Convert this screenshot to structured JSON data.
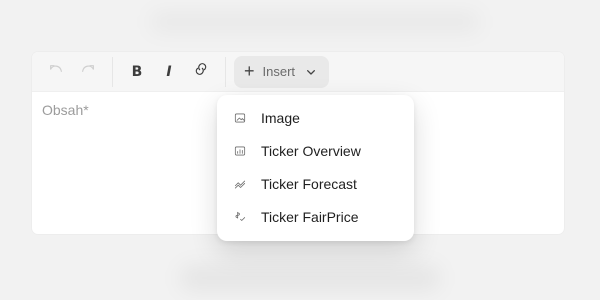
{
  "editor": {
    "placeholder": "Obsah*",
    "toolbar": {
      "insert_label": "Insert",
      "buttons": {
        "undo": {
          "icon": "undo-icon",
          "disabled": true
        },
        "redo": {
          "icon": "redo-icon",
          "disabled": true
        },
        "bold": {
          "icon": "bold-icon",
          "glyph": "B"
        },
        "italic": {
          "icon": "italic-icon",
          "glyph": "I"
        },
        "link": {
          "icon": "link-icon"
        }
      }
    }
  },
  "insert_menu": {
    "items": [
      {
        "label": "Image",
        "icon": "image-icon"
      },
      {
        "label": "Ticker Overview",
        "icon": "overview-icon"
      },
      {
        "label": "Ticker Forecast",
        "icon": "forecast-icon"
      },
      {
        "label": "Ticker FairPrice",
        "icon": "fairprice-icon"
      }
    ]
  },
  "colors": {
    "page_background": "#f2f2f2",
    "editor_background": "#ffffff",
    "toolbar_background": "#f6f6f6",
    "insert_button_background": "#e9e9e9",
    "placeholder_text": "#9c9c9c",
    "menu_text": "#1f1f1f",
    "icon_gray": "#6d6d6d",
    "disabled_icon": "#cfcfcf"
  }
}
